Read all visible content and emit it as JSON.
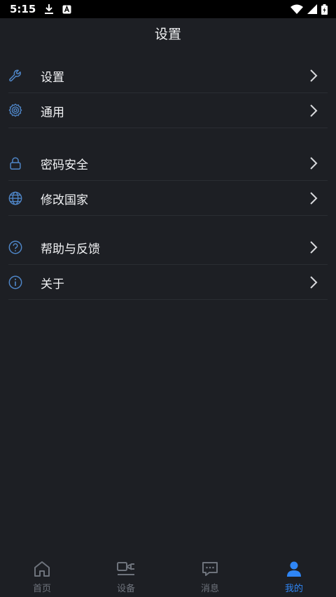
{
  "status_bar": {
    "time": "5:15"
  },
  "header": {
    "title": "设置"
  },
  "groups": [
    {
      "items": [
        {
          "label": "设置",
          "icon": "wrench-icon"
        },
        {
          "label": "通用",
          "icon": "gear-icon"
        }
      ]
    },
    {
      "items": [
        {
          "label": "密码安全",
          "icon": "lock-icon"
        },
        {
          "label": "修改国家",
          "icon": "globe-icon"
        }
      ]
    },
    {
      "items": [
        {
          "label": "帮助与反馈",
          "icon": "question-icon"
        },
        {
          "label": "关于",
          "icon": "info-icon"
        }
      ]
    }
  ],
  "tabbar": {
    "tabs": [
      {
        "label": "首页",
        "icon": "home-icon"
      },
      {
        "label": "设备",
        "icon": "device-icon"
      },
      {
        "label": "消息",
        "icon": "message-icon"
      },
      {
        "label": "我的",
        "icon": "user-icon"
      }
    ],
    "active": "我的"
  },
  "colors": {
    "background": "#1d1f24",
    "accent": "#2f86f6",
    "icon_blue": "#4f86c8",
    "inactive": "#6e737c"
  }
}
